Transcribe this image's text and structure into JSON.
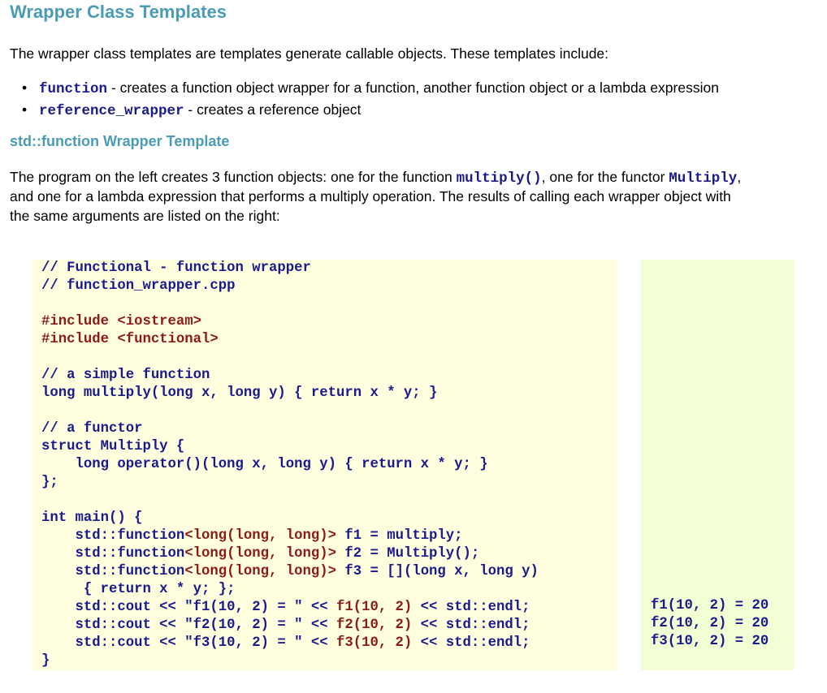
{
  "title": "Wrapper Class Templates",
  "intro": "The wrapper class templates are templates generate callable objects.  These templates include:",
  "list": [
    {
      "code": "function",
      "text": " - creates a function object wrapper for a function, another function object or a lambda expression"
    },
    {
      "code": "reference_wrapper",
      "text": " - creates a reference object"
    }
  ],
  "subtitle": "std::function Wrapper Template",
  "desc": {
    "line1_pre": "The program on the left creates 3 function objects: one for the function ",
    "line1_code1": "multiply()",
    "line1_mid": ", one for the functor ",
    "line1_code2": "Multiply",
    "line1_post": ",",
    "line2": "and one for a lambda expression that performs a multiply operation.  The results of calling each wrapper object with",
    "line3": "the same arguments are listed on the right:"
  },
  "code_lines": [
    "// Functional - function wrapper",
    "// function_wrapper.cpp",
    "",
    "#include <iostream>",
    "#include <functional>",
    "",
    "// a simple function",
    "long multiply(long x, long y) { return x * y; }",
    "",
    "// a functor",
    "struct Multiply {",
    "    long operator()(long x, long y) { return x * y; }",
    "};",
    "",
    "int main() {",
    "    std::function<long(long, long)> f1 = multiply;",
    "    std::function<long(long, long)> f2 = Multiply();",
    "    std::function<long(long, long)> f3 = [](long x, long y)",
    "     { return x * y; };",
    "    std::cout << \"f1(10, 2) = \" << f1(10, 2) << std::endl;",
    "    std::cout << \"f2(10, 2) = \" << f2(10, 2) << std::endl;",
    "    std::cout << \"f3(10, 2) = \" << f3(10, 2) << std::endl;",
    "}"
  ],
  "output_lines": [
    "f1(10, 2) = 20",
    "f2(10, 2) = 20",
    "f3(10, 2) = 20"
  ]
}
